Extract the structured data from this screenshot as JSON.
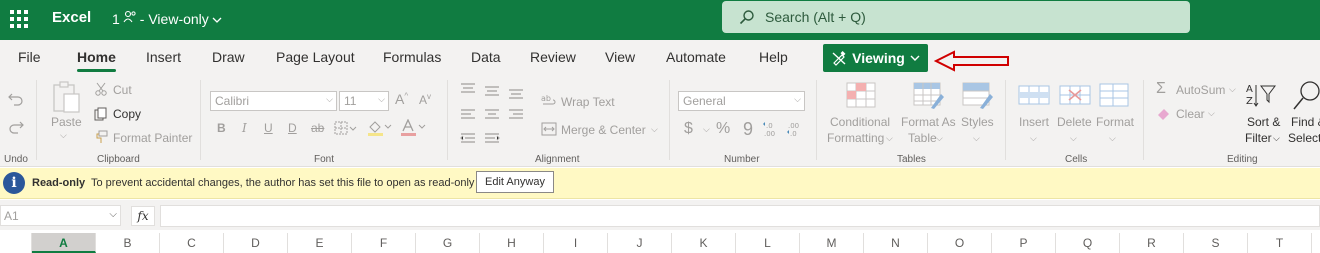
{
  "titlebar": {
    "app_name": "Excel",
    "file_name": "1",
    "file_status": "- View-only",
    "search_placeholder": "Search (Alt + Q)"
  },
  "tabs": [
    "File",
    "Home",
    "Insert",
    "Draw",
    "Page Layout",
    "Formulas",
    "Data",
    "Review",
    "View",
    "Automate",
    "Help"
  ],
  "active_tab": "Home",
  "viewing_button": "Viewing",
  "ribbon": {
    "undo_group": "Undo",
    "clipboard": {
      "paste": "Paste",
      "cut": "Cut",
      "copy": "Copy",
      "format_painter": "Format Painter",
      "group": "Clipboard"
    },
    "font": {
      "font_name": "Calibri",
      "font_size": "11",
      "bold": "B",
      "italic": "I",
      "underline": "U",
      "double_underline": "D",
      "strike": "ab",
      "group": "Font"
    },
    "alignment": {
      "wrap_text": "Wrap Text",
      "merge_center": "Merge & Center",
      "group": "Alignment"
    },
    "number": {
      "format": "General",
      "currency": "$",
      "percent": "%",
      "comma": "9",
      "group": "Number"
    },
    "tables": {
      "conditional": "Conditional",
      "formatting": "Formatting",
      "format_as": "Format As",
      "table": "Table",
      "styles": "Styles",
      "group": "Tables"
    },
    "cells": {
      "insert": "Insert",
      "delete": "Delete",
      "format": "Format",
      "group": "Cells"
    },
    "editing": {
      "autosum": "AutoSum",
      "clear": "Clear",
      "sort": "Sort &",
      "filter": "Filter",
      "find": "Find &",
      "select": "Select",
      "group": "Editing"
    }
  },
  "infobar": {
    "label": "Read-only",
    "message": "To prevent accidental changes, the author has set this file to open as read-only",
    "button": "Edit Anyway"
  },
  "formula_bar": {
    "name_box": "A1",
    "fx": "fx",
    "value": ""
  },
  "columns": [
    "A",
    "B",
    "C",
    "D",
    "E",
    "F",
    "G",
    "H",
    "I",
    "J",
    "K",
    "L",
    "M",
    "N",
    "O",
    "P",
    "Q",
    "R",
    "S",
    "T"
  ],
  "selected_column": "A",
  "colors": {
    "brand": "#107c41",
    "annotation_arrow": "#d00000",
    "infobar_bg": "#fff9c4"
  }
}
